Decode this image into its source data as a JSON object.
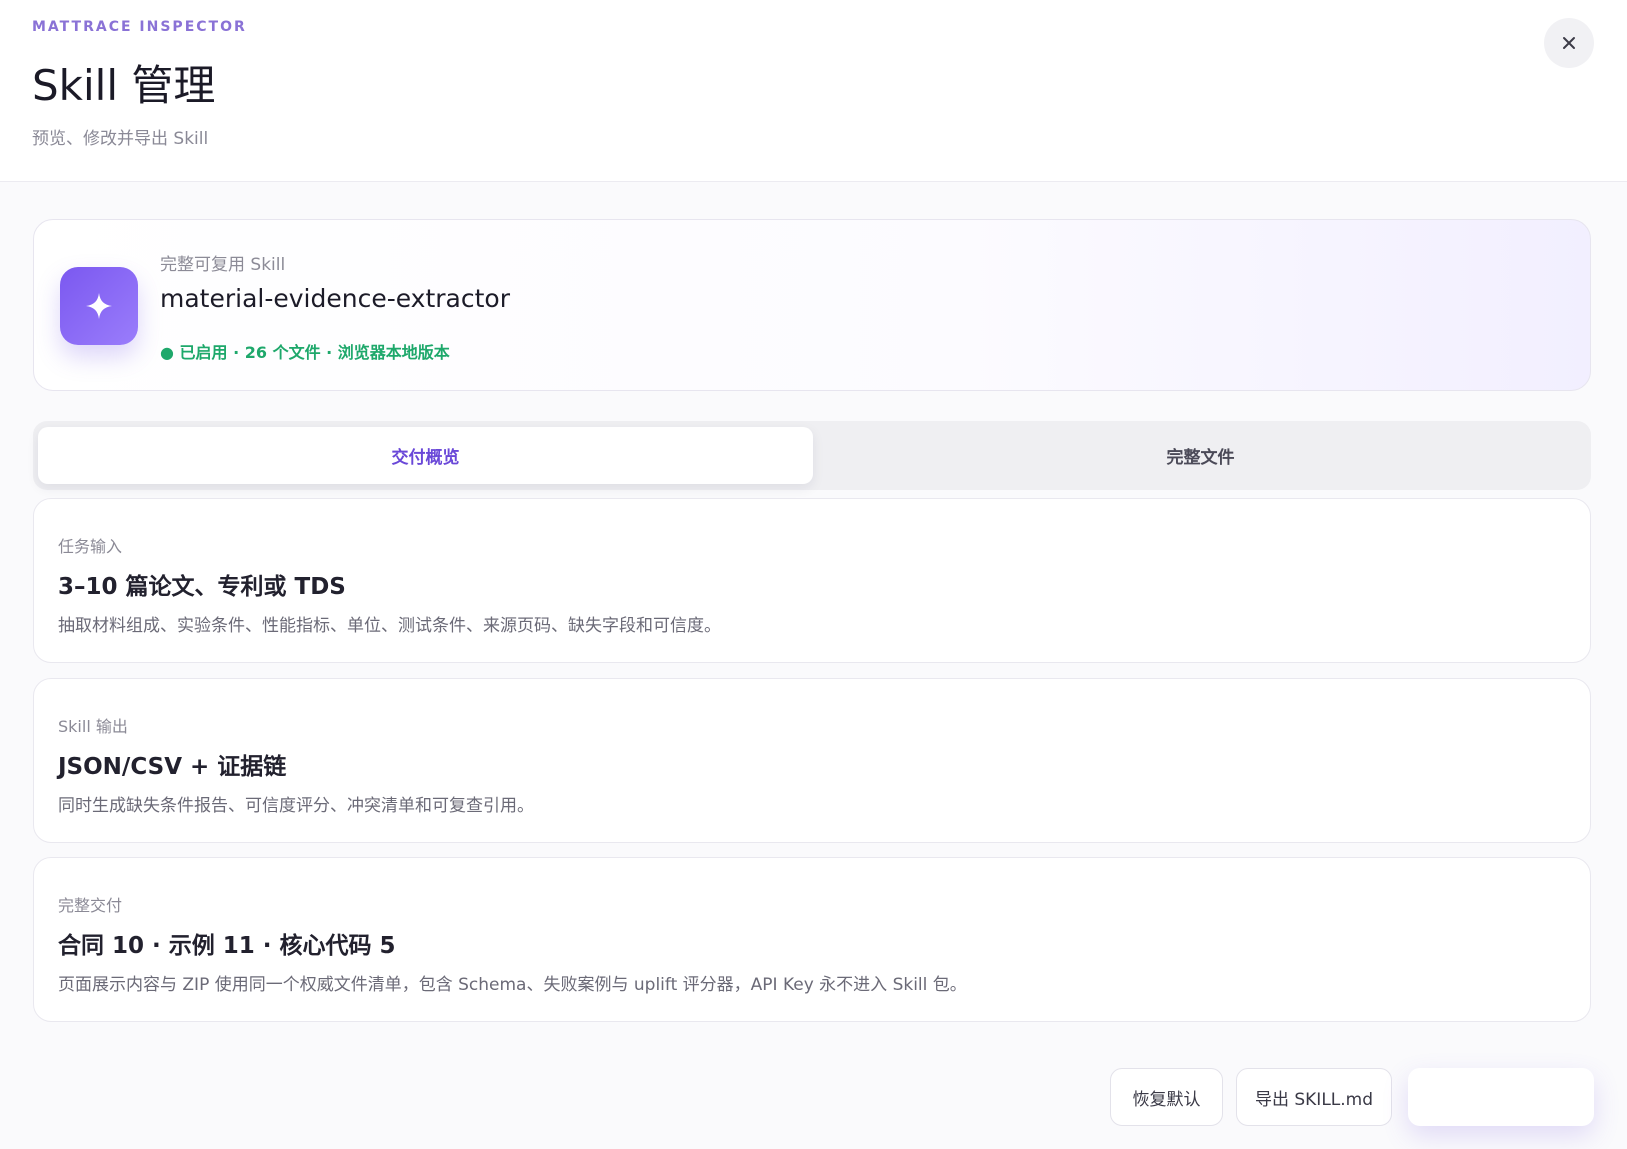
{
  "header": {
    "eyebrow": "MATTRACE INSPECTOR",
    "title": "Skill 管理",
    "subtitle": "预览、修改并导出 Skill",
    "close_icon": "close-icon"
  },
  "skill": {
    "icon": "sparkle-icon",
    "kicker": "完整可复用 Skill",
    "name": "material-evidence-extractor",
    "status": "● 已启用 · 26 个文件 · 浏览器本地版本",
    "status_color": "#1ea86b",
    "accent_color": "#7b58f0"
  },
  "tabs": [
    {
      "label": "交付概览",
      "active": true
    },
    {
      "label": "完整文件",
      "active": false
    }
  ],
  "cards": [
    {
      "label": "任务输入",
      "title": "3–10 篇论文、专利或 TDS",
      "description": "抽取材料组成、实验条件、性能指标、单位、测试条件、来源页码、缺失字段和可信度。"
    },
    {
      "label": "Skill 输出",
      "title": "JSON/CSV + 证据链",
      "description": "同时生成缺失条件报告、可信度评分、冲突清单和可复查引用。"
    },
    {
      "label": "完整交付",
      "title": "合同 10 · 示例 11 · 核心代码 5",
      "description": "页面展示内容与 ZIP 使用同一个权威文件清单，包含 Schema、失败案例与 uplift 评分器，API Key 永不进入 Skill 包。"
    }
  ],
  "footer": {
    "restore_label": "恢复默认",
    "export_md_label": "导出 SKILL.md",
    "export_zip_label": ""
  }
}
